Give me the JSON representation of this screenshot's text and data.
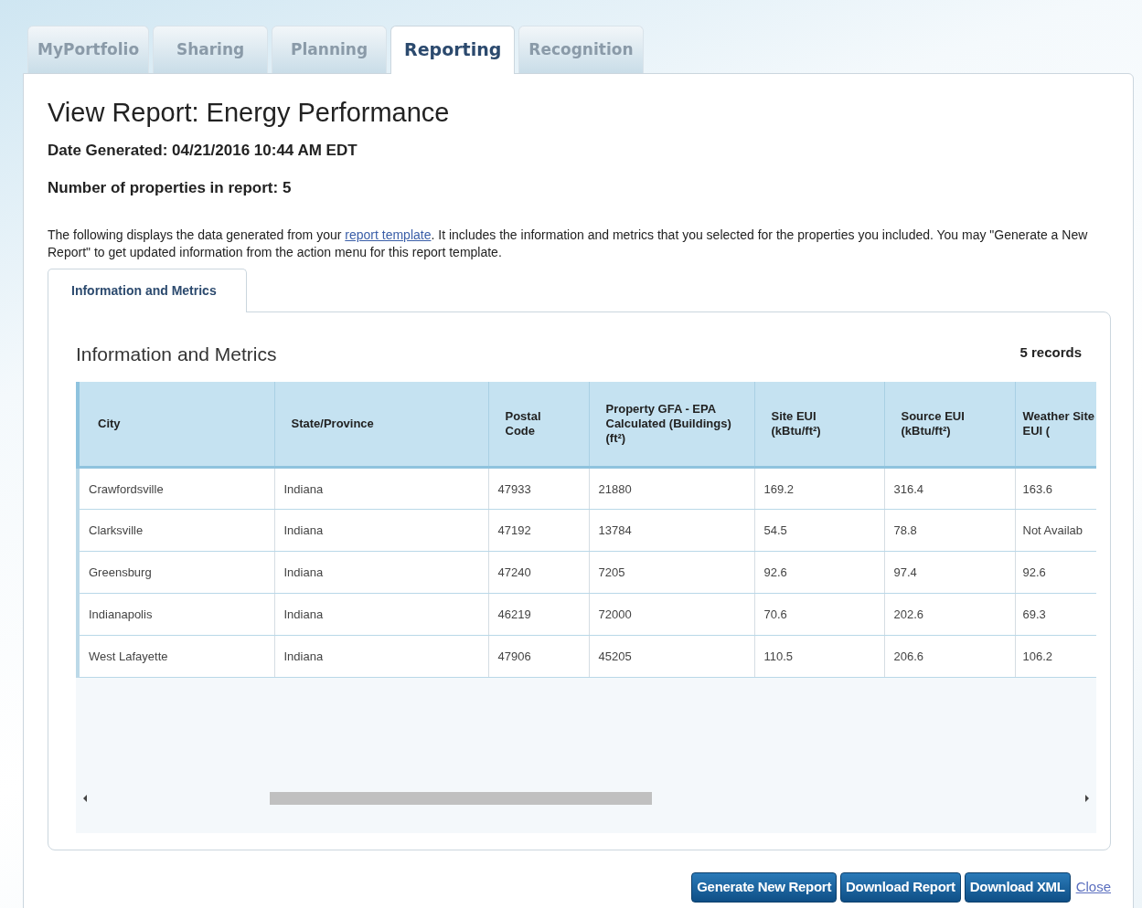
{
  "tabs": [
    {
      "label": "MyPortfolio",
      "selected": false
    },
    {
      "label": "Sharing",
      "selected": false
    },
    {
      "label": "Planning",
      "selected": false
    },
    {
      "label": "Reporting",
      "selected": true
    },
    {
      "label": "Recognition",
      "selected": false
    }
  ],
  "report": {
    "title": "View Report: Energy Performance",
    "date_generated": "Date Generated: 04/21/2016 10:44 AM EDT",
    "property_count": "Number of properties in report: 5",
    "intro": {
      "before": "The following displays the data generated from your",
      "link": "report template",
      "after": ". It includes the information and metrics that you selected for the properties you included. You may \"Generate a New Report\" to get updated information from the action menu for this report template."
    }
  },
  "subtabs": [
    {
      "label": "Information and Metrics",
      "selected": true
    }
  ],
  "table": {
    "title": "Information and Metrics",
    "record_count": "5 records",
    "columns": [
      "City",
      "State/Province",
      "Postal Code",
      "Property GFA - EPA Calculated (Buildings) (ft²)",
      "Site EUI (kBtu/ft²)",
      "Source EUI (kBtu/ft²)",
      "Weather Site EUI ("
    ],
    "rows": [
      [
        "Crawfordsville",
        "Indiana",
        "47933",
        "21880",
        "169.2",
        "316.4",
        "163.6"
      ],
      [
        "Clarksville",
        "Indiana",
        "47192",
        "13784",
        "54.5",
        "78.8",
        "Not Availab"
      ],
      [
        "Greensburg",
        "Indiana",
        "47240",
        "7205",
        "92.6",
        "97.4",
        "92.6"
      ],
      [
        "Indianapolis",
        "Indiana",
        "46219",
        "72000",
        "70.6",
        "202.6",
        "69.3"
      ],
      [
        "West Lafayette",
        "Indiana",
        "47906",
        "45205",
        "110.5",
        "206.6",
        "106.2"
      ]
    ]
  },
  "buttons": [
    "Generate New Report",
    "Download Report",
    "Download XML"
  ],
  "close_link": "Close"
}
